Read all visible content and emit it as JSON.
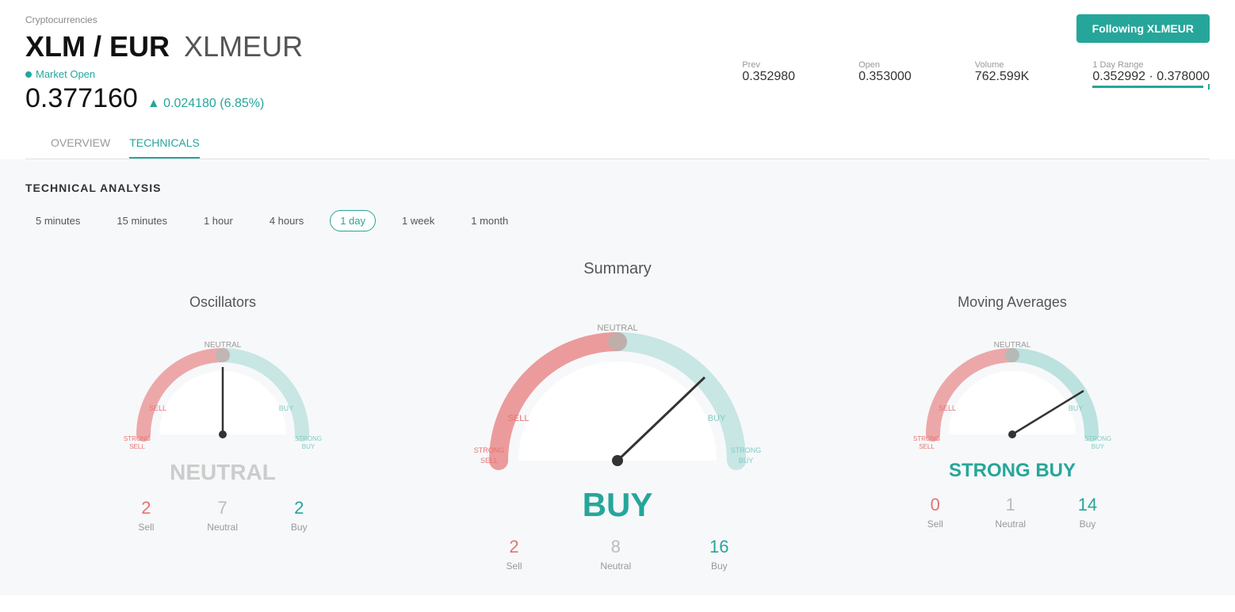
{
  "header": {
    "breadcrumb": "Cryptocurrencies",
    "title": "XLM / EUR",
    "ticker": "XLMEUR",
    "follow_button": "Following XLMEUR",
    "market_status": "Market Open",
    "price": "0.377160",
    "price_change": "▲ 0.024180 (6.85%)",
    "stats": {
      "prev_label": "Prev",
      "prev_value": "0.352980",
      "open_label": "Open",
      "open_value": "0.353000",
      "volume_label": "Volume",
      "volume_value": "762.599K",
      "range_label": "1 Day Range",
      "range_value": "0.352992 · 0.378000"
    }
  },
  "tabs": [
    {
      "label": "OVERVIEW",
      "active": false
    },
    {
      "label": "TECHNICALS",
      "active": true
    }
  ],
  "technical_analysis": {
    "title": "TECHNICAL ANALYSIS",
    "time_filters": [
      {
        "label": "5 minutes",
        "active": false
      },
      {
        "label": "15 minutes",
        "active": false
      },
      {
        "label": "1 hour",
        "active": false
      },
      {
        "label": "4 hours",
        "active": false
      },
      {
        "label": "1 day",
        "active": true
      },
      {
        "label": "1 week",
        "active": false
      },
      {
        "label": "1 month",
        "active": false
      }
    ],
    "summary_title": "Summary",
    "oscillators": {
      "title": "Oscillators",
      "result": "NEUTRAL",
      "result_class": "neutral",
      "needle_angle": -90,
      "counts": [
        {
          "value": "2",
          "label": "Sell",
          "class": "sell"
        },
        {
          "value": "7",
          "label": "Neutral",
          "class": "neutral"
        },
        {
          "value": "2",
          "label": "Buy",
          "class": "buy"
        }
      ]
    },
    "summary": {
      "result": "BUY",
      "result_class": "buy",
      "needle_angle": 30,
      "counts": [
        {
          "value": "2",
          "label": "Sell",
          "class": "sell"
        },
        {
          "value": "8",
          "label": "Neutral",
          "class": "neutral"
        },
        {
          "value": "16",
          "label": "Buy",
          "class": "buy"
        }
      ]
    },
    "moving_averages": {
      "title": "Moving Averages",
      "result": "STRONG BUY",
      "result_class": "strong-buy",
      "needle_angle": 50,
      "counts": [
        {
          "value": "0",
          "label": "Sell",
          "class": "sell"
        },
        {
          "value": "1",
          "label": "Neutral",
          "class": "neutral"
        },
        {
          "value": "14",
          "label": "Buy",
          "class": "buy"
        }
      ]
    }
  }
}
